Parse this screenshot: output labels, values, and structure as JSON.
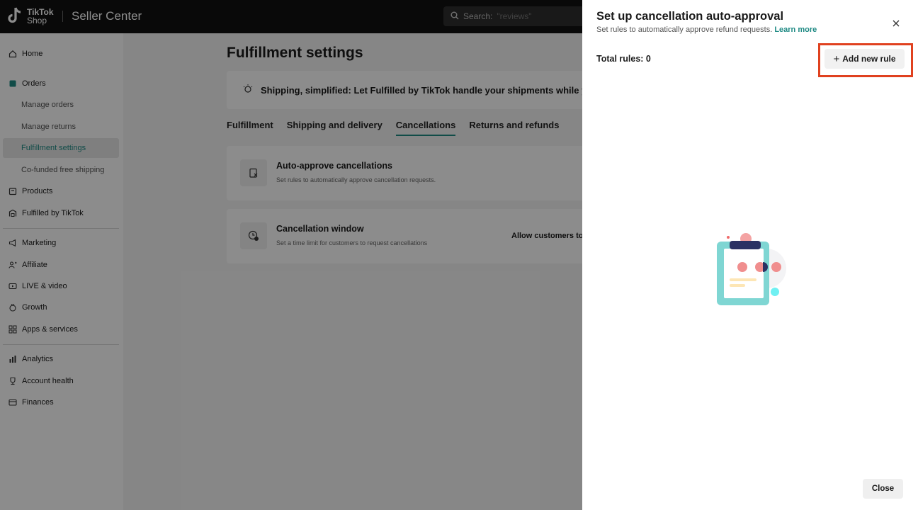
{
  "topbar": {
    "logo_line1": "TikTok",
    "logo_line2": "Shop",
    "title": "Seller Center",
    "search_label": "Search:",
    "search_placeholder": "\"reviews\""
  },
  "sidebar": {
    "items": [
      {
        "label": "Home",
        "icon": "home-icon"
      },
      {
        "label": "Orders",
        "icon": "orders-icon"
      },
      {
        "label": "Manage orders"
      },
      {
        "label": "Manage returns"
      },
      {
        "label": "Fulfillment settings"
      },
      {
        "label": "Co-funded free shipping"
      },
      {
        "label": "Products",
        "icon": "products-icon"
      },
      {
        "label": "Fulfilled by TikTok",
        "icon": "warehouse-icon"
      },
      {
        "label": "Marketing",
        "icon": "megaphone-icon"
      },
      {
        "label": "Affiliate",
        "icon": "affiliate-icon"
      },
      {
        "label": "LIVE & video",
        "icon": "video-icon"
      },
      {
        "label": "Growth",
        "icon": "growth-icon"
      },
      {
        "label": "Apps & services",
        "icon": "apps-icon"
      },
      {
        "label": "Analytics",
        "icon": "analytics-icon"
      },
      {
        "label": "Account health",
        "icon": "trophy-icon"
      },
      {
        "label": "Finances",
        "icon": "finance-icon"
      }
    ]
  },
  "main": {
    "title": "Fulfillment settings",
    "banner": "Shipping, simplified: Let Fulfilled by TikTok handle your shipments while you",
    "tabs": [
      "Fulfillment",
      "Shipping and delivery",
      "Cancellations",
      "Returns and refunds"
    ],
    "cards": [
      {
        "title": "Auto-approve cancellations",
        "subtitle": "Set rules to automatically approve cancellation requests.",
        "right": ""
      },
      {
        "title": "Cancellation window",
        "subtitle": "Set a time limit for customers to request cancellations",
        "right": "Allow customers to"
      }
    ]
  },
  "drawer": {
    "title": "Set up cancellation auto-approval",
    "subtitle": "Set rules to automatically approve refund requests.",
    "learn_more": "Learn more",
    "total_rules": "Total rules: 0",
    "add_rule": "Add new rule",
    "close_button": "Close"
  },
  "colors": {
    "accent": "#1f8a84",
    "highlight": "#e0411f",
    "topbar": "#121212"
  }
}
